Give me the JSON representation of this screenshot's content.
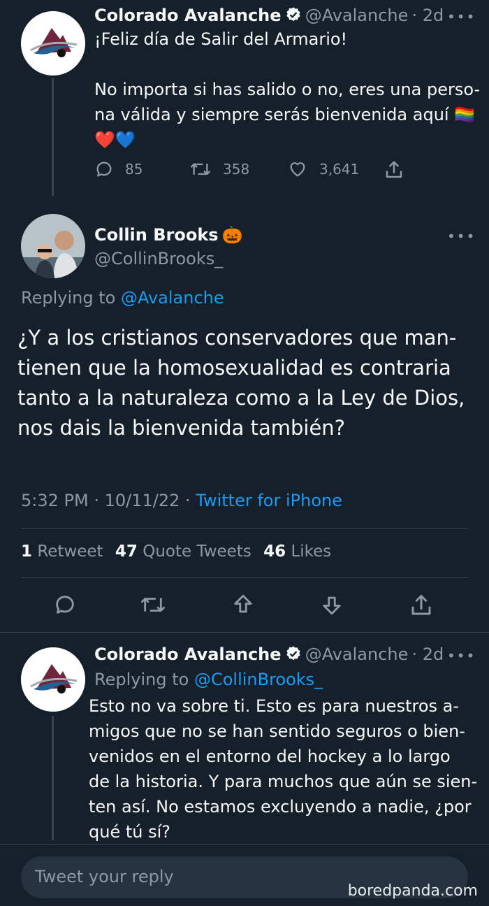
{
  "tweet1": {
    "author_name": "Colorado Avalanche",
    "author_handle": "@Avalanche",
    "age": "· 2d",
    "line1": "¡Feliz día de Salir del Armario!",
    "line2": "No importa si has salido o no, eres una perso-",
    "line3": "na válida y siempre serás bienvenida aquí 🏳️‍🌈",
    "line4": "❤️💙",
    "replies": "85",
    "retweets": "358",
    "likes": "3,641"
  },
  "main_tweet": {
    "author_name": "Collin Brooks",
    "author_emoji": "🎃",
    "author_handle": "@CollinBrooks_",
    "replying_prefix": "Replying to",
    "replying_to": "@Avalanche",
    "lines": [
      "¿Y a los cristianos conservadores que man-",
      "tienen que la homosexualidad es contraria",
      "tanto a la naturaleza como a la Ley de Dios,",
      "nos dais la bienvenida también?"
    ],
    "timestamp": "5:32 PM · 10/11/22 ·",
    "source": "Twitter for iPhone",
    "retweet_count": "1",
    "retweet_label": "Retweet",
    "quote_count": "47",
    "quote_label": "Quote Tweets",
    "like_count": "46",
    "like_label": "Likes"
  },
  "tweet3": {
    "author_name": "Colorado Avalanche",
    "author_handle": "@Avalanche",
    "age": "· 2d",
    "replying_prefix": "Replying to",
    "replying_to": "@CollinBrooks_",
    "lines": [
      "Esto no va sobre ti. Esto es para nuestros a-",
      "migos que no se han sentido seguros o bien-",
      "venidos en el entorno del hockey a lo largo",
      "de la historia. Y para muchos que aún se sien-",
      "ten así. No estamos excluyendo a nadie, ¿por",
      "qué tú sí?"
    ]
  },
  "reply_box": {
    "placeholder": "Tweet your reply"
  },
  "watermark": "boredpanda.com",
  "colors": {
    "background": "#15202b",
    "accent": "#1d9bf0",
    "muted": "#8b98a5"
  }
}
